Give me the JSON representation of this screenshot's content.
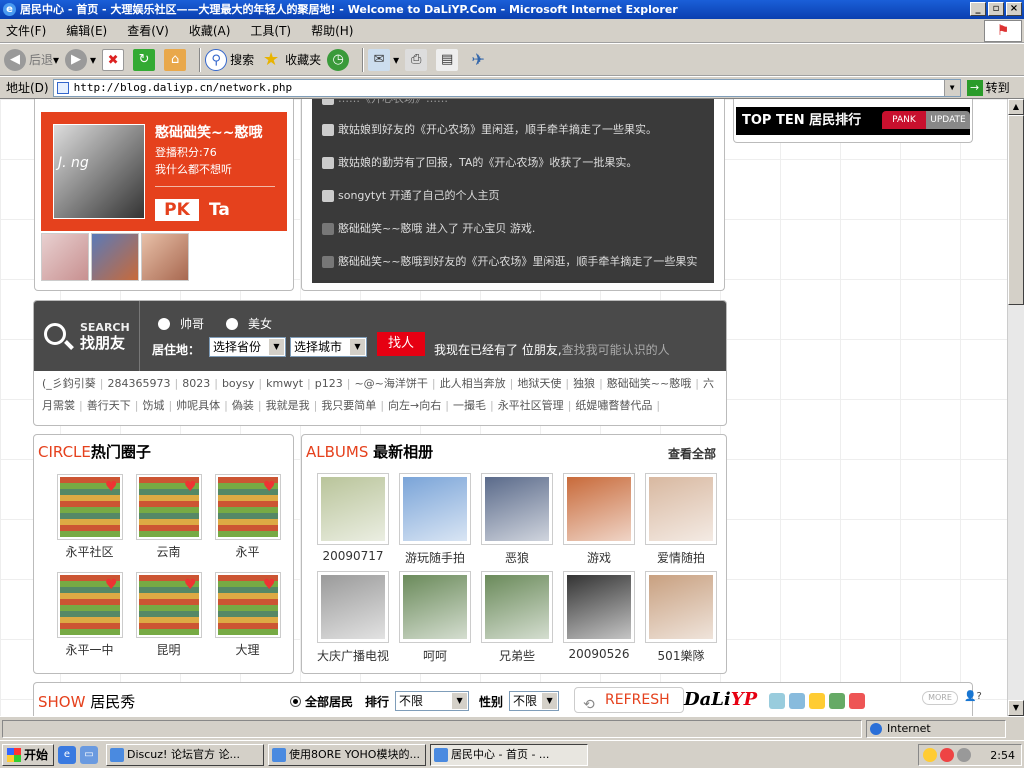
{
  "window": {
    "title": "居民中心 - 首页 - 大理娱乐社区——大理最大的年轻人的聚居地! - Welcome to DaLiYP.Com - Microsoft Internet Explorer"
  },
  "menu": [
    "文件(F)",
    "编辑(E)",
    "查看(V)",
    "收藏(A)",
    "工具(T)",
    "帮助(H)"
  ],
  "toolbar": {
    "back": "后退",
    "search": "搜索",
    "favorites": "收藏夹"
  },
  "address": {
    "label": "地址(D)",
    "url": "http://blog.daliyp.cn/network.php",
    "go": "转到"
  },
  "profile": {
    "name": "憨础础笑~~憨哦",
    "score": "登播积分:76",
    "motto": "我什么都不想听",
    "photo_text": "J. ng",
    "pk": "PK",
    "ta": "Ta"
  },
  "feed": [
    {
      "text": "敢姑娘到好友的《开心农场》里闲逛，顺手牵羊摘走了一些果实。"
    },
    {
      "text": "敢姑娘的勤劳有了回报，TA的《开心农场》收获了一批果实。"
    },
    {
      "text": "songytyt 开通了自己的个人主页"
    },
    {
      "text": "憨础础笑~~憨哦 进入了 开心宝贝 游戏."
    },
    {
      "text": "憨础础笑~~憨哦到好友的《开心农场》里闲逛，顺手牵羊摘走了一些果实"
    }
  ],
  "topten": {
    "title": "TOP TEN 居民排行",
    "tab1": "PANK",
    "tab2": "UPDATE"
  },
  "search": {
    "brand_en": "SEARCH",
    "brand_cn": "找朋友",
    "gender_male": "帅哥",
    "gender_female": "美女",
    "location_label": "居住地：",
    "province": "选择省份",
    "city": "选择城市",
    "find_button": "找人",
    "hint": "我现在已经有了 位朋友,",
    "hint_link": "查找我可能认识的人",
    "names": [
      "(_彡鈞引葵",
      "284365973",
      "8023",
      "boysy",
      "kmwyt",
      "p123",
      "~@~海洋饼干",
      "此人相当奔放",
      "地狱天使",
      "独狼",
      "憨础础笑~~憨哦",
      "六月需裳",
      "善行天下",
      "饬城",
      "帅呢具体",
      "偽装",
      "我就是我",
      "我只要简单",
      "向左→向右",
      "一撮毛",
      "永平社区管理",
      "纸媞嘯瞀替代品"
    ]
  },
  "circle": {
    "title_en": "CIRCLE",
    "title_cn": "热门圈子",
    "items": [
      "永平社区",
      "云南",
      "永平",
      "永平一中",
      "昆明",
      "大理"
    ]
  },
  "albums": {
    "title_en": "ALBUMS",
    "title_cn": "最新相册",
    "view_all": "查看全部",
    "items": [
      "20090717",
      "游玩随手拍",
      "恶狼",
      "游戏",
      "爱情随拍",
      "大庆广播电视",
      "呵呵",
      "兄弟些",
      "20090526",
      "501樂隊"
    ],
    "colors": [
      "#b9c49a",
      "#7aa4d8",
      "#5a6a8a",
      "#c86a3a",
      "#d8b8a0",
      "#9a9a9a",
      "#6a8a5a",
      "#6a8a5a",
      "#333333",
      "#c8a080"
    ]
  },
  "show": {
    "title_en": "SHOW",
    "title_cn": "居民秀",
    "all_residents": "全部居民",
    "rank_label": "排行",
    "rank_value": "不限",
    "gender_label": "性别",
    "gender_value": "不限",
    "refresh": "REFRESH",
    "logo_a": "DaLi",
    "logo_b": "YP",
    "more": "MORE"
  },
  "status": {
    "zone": "Internet"
  },
  "taskbar": {
    "start": "开始",
    "tasks": [
      "Discuz! 论坛官方 论...",
      "使用8ORE YOHO模块的...",
      "居民中心 - 首页 - ..."
    ],
    "clock": "2:54"
  }
}
